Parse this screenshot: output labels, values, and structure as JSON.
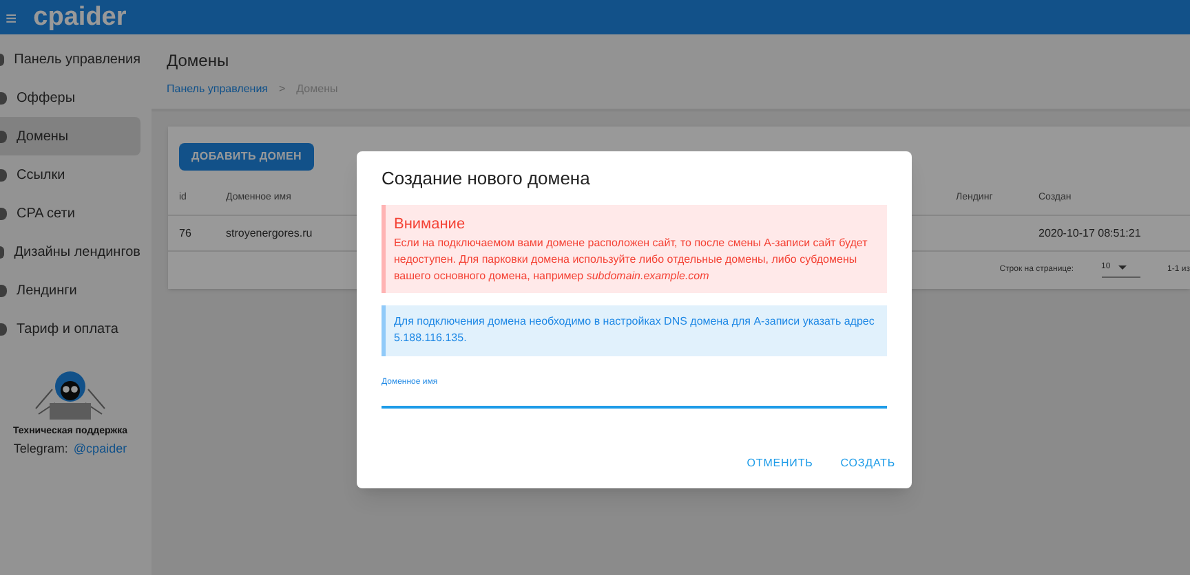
{
  "header": {
    "logo": "cpaider",
    "menu_icon": "≡"
  },
  "sidebar": {
    "items": [
      {
        "label": "Панель управления",
        "selected": false
      },
      {
        "label": "Офферы",
        "selected": false
      },
      {
        "label": "Домены",
        "selected": true
      },
      {
        "label": "Ссылки",
        "selected": false
      },
      {
        "label": "CPA сети",
        "selected": false
      },
      {
        "label": "Дизайны лендингов",
        "selected": false
      },
      {
        "label": "Лендинги",
        "selected": false
      },
      {
        "label": "Тариф и оплата",
        "selected": false
      }
    ],
    "support": {
      "title": "Техническая поддержка",
      "label": "Telegram:",
      "link": "@cpaider"
    }
  },
  "page": {
    "title": "Домены",
    "breadcrumb_separator": ">",
    "breadcrumbs": [
      {
        "label": "Панель управления",
        "link": true
      },
      {
        "label": "Домены",
        "link": false
      }
    ]
  },
  "card": {
    "add_button": "ДОБАВИТЬ ДОМЕН",
    "table": {
      "columns": [
        "id",
        "Доменное имя",
        "Лендинг",
        "Создан"
      ],
      "rows": [
        [
          "76",
          "stroyenergores.ru",
          "",
          "2020-10-17 08:51:21"
        ]
      ]
    },
    "pagination": {
      "rows_label": "Строк на странице:",
      "rows_value": "10",
      "range": "1-1 из"
    }
  },
  "dialog": {
    "title": "Создание нового домена",
    "warning": {
      "title": "Внимание",
      "text": "Если на подключаемом вами домене расположен сайт, то после смены А-записи сайт будет недоступен. Для парковки домена используйте либо отдельные домены, либо субдомены вашего основного домена, например *subdomain.example.com*"
    },
    "info": "Для подключения домена необходимо в настройках DNS домена для А-записи указать адрес 5.188.116.135.",
    "field": {
      "label": "Доменное имя"
    },
    "buttons": [
      "ОТМЕНИТЬ",
      "СОЗДАТЬ"
    ]
  }
}
